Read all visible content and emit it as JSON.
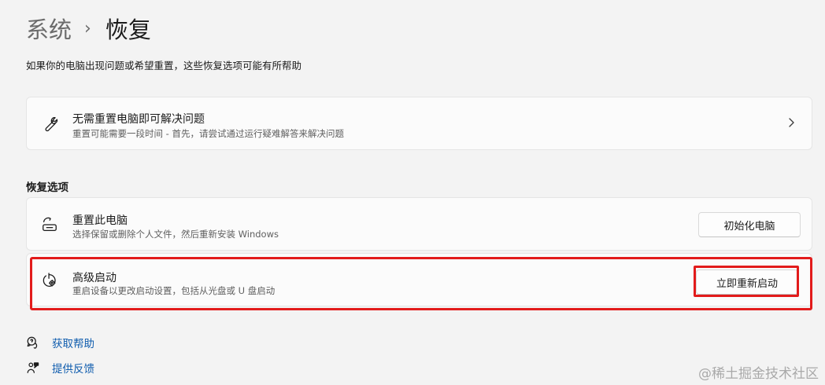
{
  "breadcrumb": {
    "parent": "系统",
    "separator": "›",
    "current": "恢复"
  },
  "subtitle": "如果你的电脑出现问题或希望重置，这些恢复选项可能有所帮助",
  "troubleshoot_card": {
    "icon": "wrench-icon",
    "title": "无需重置电脑即可解决问题",
    "description": "重置可能需要一段时间 - 首先，请尝试通过运行疑难解答来解决问题"
  },
  "section_title": "恢复选项",
  "reset_card": {
    "icon": "reset-pc-icon",
    "title": "重置此电脑",
    "description": "选择保留或删除个人文件，然后重新安装 Windows",
    "button": "初始化电脑"
  },
  "advanced_startup_card": {
    "icon": "advanced-startup-icon",
    "title": "高级启动",
    "description": "重启设备以更改启动设置，包括从光盘或 U 盘启动",
    "button": "立即重新启动",
    "highlighted": true,
    "highlight_color": "#e21b1b"
  },
  "links": {
    "help": "获取帮助",
    "feedback": "提供反馈"
  },
  "link_color": "#0f5cae",
  "watermark": "@稀土掘金技术社区"
}
